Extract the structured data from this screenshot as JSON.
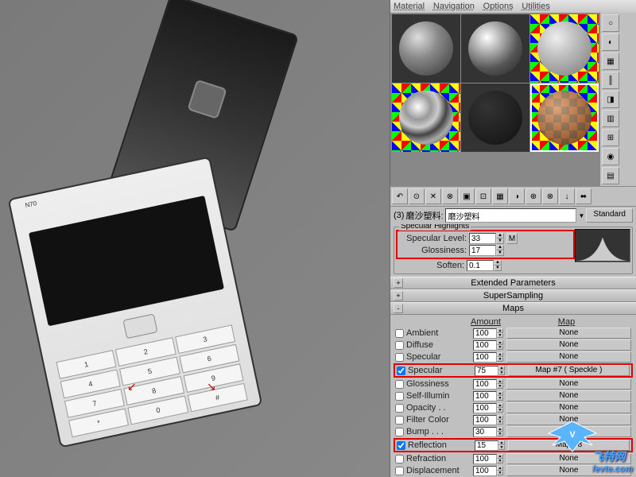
{
  "menubar": {
    "items": [
      "Material",
      "Navigation",
      "Options",
      "Utilities"
    ]
  },
  "material_slots": [
    {
      "style": "sp-gray",
      "selected": false
    },
    {
      "style": "sp-glossy",
      "selected": false
    },
    {
      "style": "sp-num",
      "selected": false
    },
    {
      "style": "sp-chrome",
      "selected": false
    },
    {
      "style": "sp-dark",
      "selected": false
    },
    {
      "style": "sp-check",
      "selected": true
    }
  ],
  "side_tools": [
    "○",
    "◐",
    "▦",
    "║",
    "◨",
    "▥",
    "⊞",
    "◉",
    "▤"
  ],
  "toolbar_icons": [
    "↶",
    "⊙",
    "✕",
    "⊗",
    "▣",
    "⊡",
    "▦",
    "◑",
    "⊕",
    "⊗",
    "↓",
    "⬌",
    "⊞",
    "⬍"
  ],
  "material_name": {
    "index": "(3)",
    "prefix": "磨沙塑料:",
    "name": "磨沙塑料",
    "type": "Standard"
  },
  "spec_highlights": {
    "title": "Specular Highlights",
    "specular_level": {
      "label": "Specular Level:",
      "value": "33",
      "m_label": "M"
    },
    "glossiness": {
      "label": "Glossiness:",
      "value": "17"
    },
    "soften": {
      "label": "Soften:",
      "value": "0.1"
    }
  },
  "rollouts": {
    "extended": "Extended Parameters",
    "supersampling": "SuperSampling",
    "maps": "Maps"
  },
  "maps": {
    "headers": {
      "amount": "Amount",
      "map": "Map"
    },
    "rows": [
      {
        "name": "Ambient",
        "checked": false,
        "amount": "100",
        "map": "None",
        "disabled": true,
        "hl": false
      },
      {
        "name": "Diffuse",
        "checked": false,
        "amount": "100",
        "map": "None",
        "hl": false
      },
      {
        "name": "Specular",
        "checked": false,
        "amount": "100",
        "map": "None",
        "hl": false
      },
      {
        "name": "Specular",
        "checked": true,
        "amount": "75",
        "map": "Map #7  ( Speckle )",
        "hl": true
      },
      {
        "name": "Glossiness",
        "checked": false,
        "amount": "100",
        "map": "None",
        "hl": false
      },
      {
        "name": "Self-Illumin",
        "checked": false,
        "amount": "100",
        "map": "None",
        "hl": false
      },
      {
        "name": "Opacity . .",
        "checked": false,
        "amount": "100",
        "map": "None",
        "hl": false
      },
      {
        "name": "Filter Color",
        "checked": false,
        "amount": "100",
        "map": "None",
        "hl": false
      },
      {
        "name": "Bump . . .",
        "checked": false,
        "amount": "30",
        "map": "None",
        "hl": false
      },
      {
        "name": "Reflection",
        "checked": true,
        "amount": "15",
        "map": "Map #8",
        "hl": true
      },
      {
        "name": "Refraction",
        "checked": false,
        "amount": "100",
        "map": "None",
        "hl": false
      },
      {
        "name": "Displacement",
        "checked": false,
        "amount": "100",
        "map": "None",
        "hl": false
      }
    ]
  },
  "phone_label": "N70",
  "watermark": "fevte.com",
  "watermark_brand": "飞特网"
}
